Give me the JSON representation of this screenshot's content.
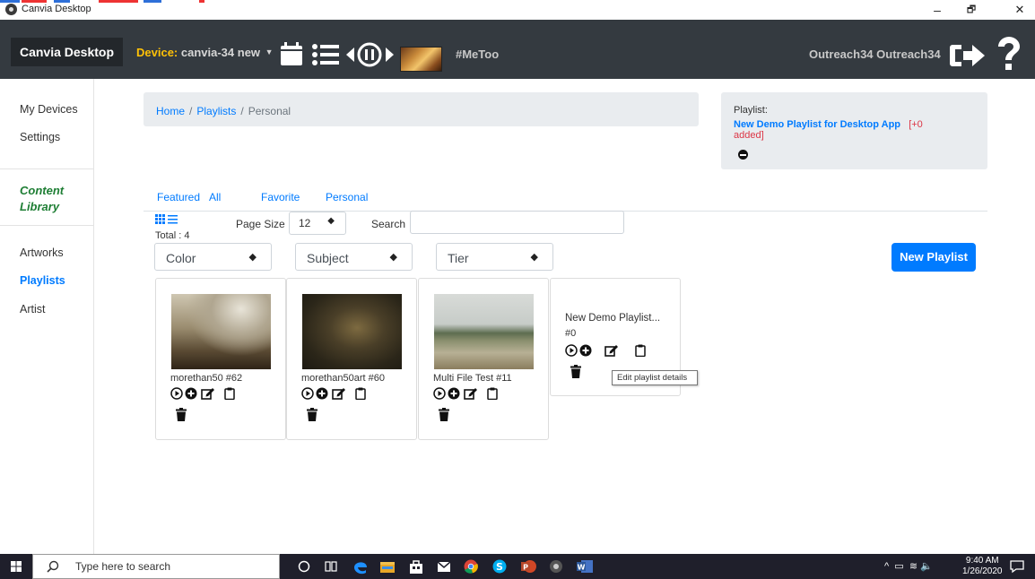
{
  "window": {
    "title": "Canvia Desktop",
    "minimize": "–",
    "maximize": "🗗",
    "close": "✕"
  },
  "navbar": {
    "brand": "Canvia Desktop",
    "device_label": "Device:",
    "device_name": "canvia-34 new",
    "hashtag": "#MeToo",
    "user": "Outreach34 Outreach34"
  },
  "sidebar": {
    "my_devices": "My Devices",
    "settings": "Settings",
    "content_library_1": "Content",
    "content_library_2": "Library",
    "artworks": "Artworks",
    "playlists": "Playlists",
    "artist": "Artist"
  },
  "breadcrumb": {
    "home": "Home",
    "playlists": "Playlists",
    "current": "Personal",
    "sep": "/"
  },
  "playlist_box": {
    "label": "Playlist:",
    "name": "New Demo Playlist for Desktop App",
    "added_1": "[+0",
    "added_2": "added]"
  },
  "tabs": [
    "Featured",
    "All",
    "Favorite",
    "Personal"
  ],
  "controls": {
    "total": "Total : 4",
    "page_size_label": "Page Size",
    "page_size_value": "12",
    "search_label": "Search",
    "search_value": ""
  },
  "filters": [
    "Color",
    "Subject",
    "Tier"
  ],
  "new_playlist_button": "New Playlist",
  "cards": [
    {
      "caption": "morethan50 #62"
    },
    {
      "caption": "morethan50art #60"
    },
    {
      "caption": "Multi File Test #11"
    },
    {
      "title": "New Demo Playlist...",
      "count": "#0"
    }
  ],
  "tooltip": "Edit playlist details",
  "taskbar": {
    "search_placeholder": "Type here to search",
    "time": "9:40 AM",
    "date": "1/26/2020"
  },
  "colors": {
    "navbar": "#343a40",
    "brand_bg": "#23272b",
    "device_label": "#ffc107",
    "primary": "#007bff",
    "danger": "#dc3545",
    "content_library": "#1e7e34"
  }
}
